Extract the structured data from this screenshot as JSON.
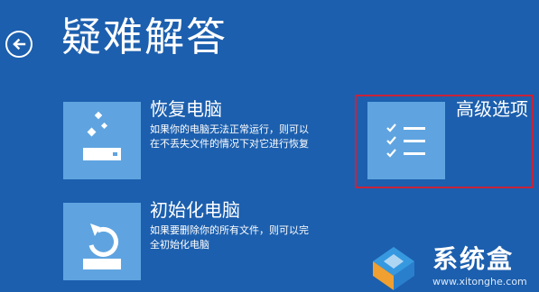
{
  "header": {
    "title": "疑难解答",
    "back_icon": "back-arrow-icon"
  },
  "options": [
    {
      "title": "恢复电脑",
      "description_lines": [
        "如果你的电脑无法正常运行，则可以",
        "在不丢失文件的情况下对它进行恢复"
      ],
      "icon": "recovery-sparkle-icon"
    },
    {
      "title": "初始化电脑",
      "description_lines": [
        "如果要删除你的所有文件，则可以完",
        "全初始化电脑"
      ],
      "icon": "reset-refresh-icon"
    },
    {
      "title": "高级选项",
      "icon": "checklist-icon",
      "highlighted": true
    }
  ],
  "watermark": {
    "name": "系统盒",
    "url": "www.xitonghe.com"
  },
  "colors": {
    "background": "#1c5fae",
    "tile": "#5fa4e0",
    "highlight_border": "#c8233a"
  }
}
